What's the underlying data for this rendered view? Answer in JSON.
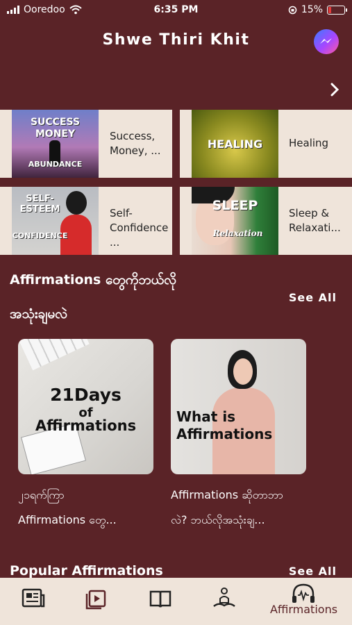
{
  "status_bar": {
    "carrier": "Ooredoo",
    "time": "6:35 PM",
    "battery": "15%"
  },
  "header": {
    "title": "Shwe Thiri Khit"
  },
  "categories": [
    {
      "label": "Success, Money, ...",
      "thumb_line1": "SUCCESS",
      "thumb_line2": "MONEY",
      "thumb_line3": "ABUNDANCE"
    },
    {
      "label": "Healing",
      "thumb_line1": "HEALING"
    },
    {
      "label": "Self-Confidence ...",
      "thumb_line1": "SELF-",
      "thumb_line2": "ESTEEM",
      "thumb_line3": "CONFIDENCE"
    },
    {
      "label": "Sleep & Relaxati...",
      "thumb_line1": "SLEEP",
      "thumb_line2": "Relaxation"
    }
  ],
  "section_howto": {
    "title_line1": "Affirmations တွေကိုဘယ်လို",
    "title_line2": "အသုံးချမလဲ",
    "see_all": "See All",
    "cards": [
      {
        "image_line1": "21Days",
        "image_line2": "of",
        "image_line3": "Affirmations",
        "caption_line1": "၂၁ရက်ကြာ",
        "caption_line2": "Affirmations တွေ..."
      },
      {
        "image_line1": "What is",
        "image_line2": "Affirmations",
        "caption_line1": "Affirmations ဆိုတာဘာ",
        "caption_line2": "လဲ? ဘယ်လိုအသုံးချ..."
      }
    ]
  },
  "section_popular": {
    "title": "Popular Affirmations",
    "see_all": "See All"
  },
  "tabbar": {
    "active_label": "Affirmations"
  },
  "colors": {
    "background": "#5a2327",
    "tile": "#efe4da",
    "accent": "#5a2327"
  }
}
